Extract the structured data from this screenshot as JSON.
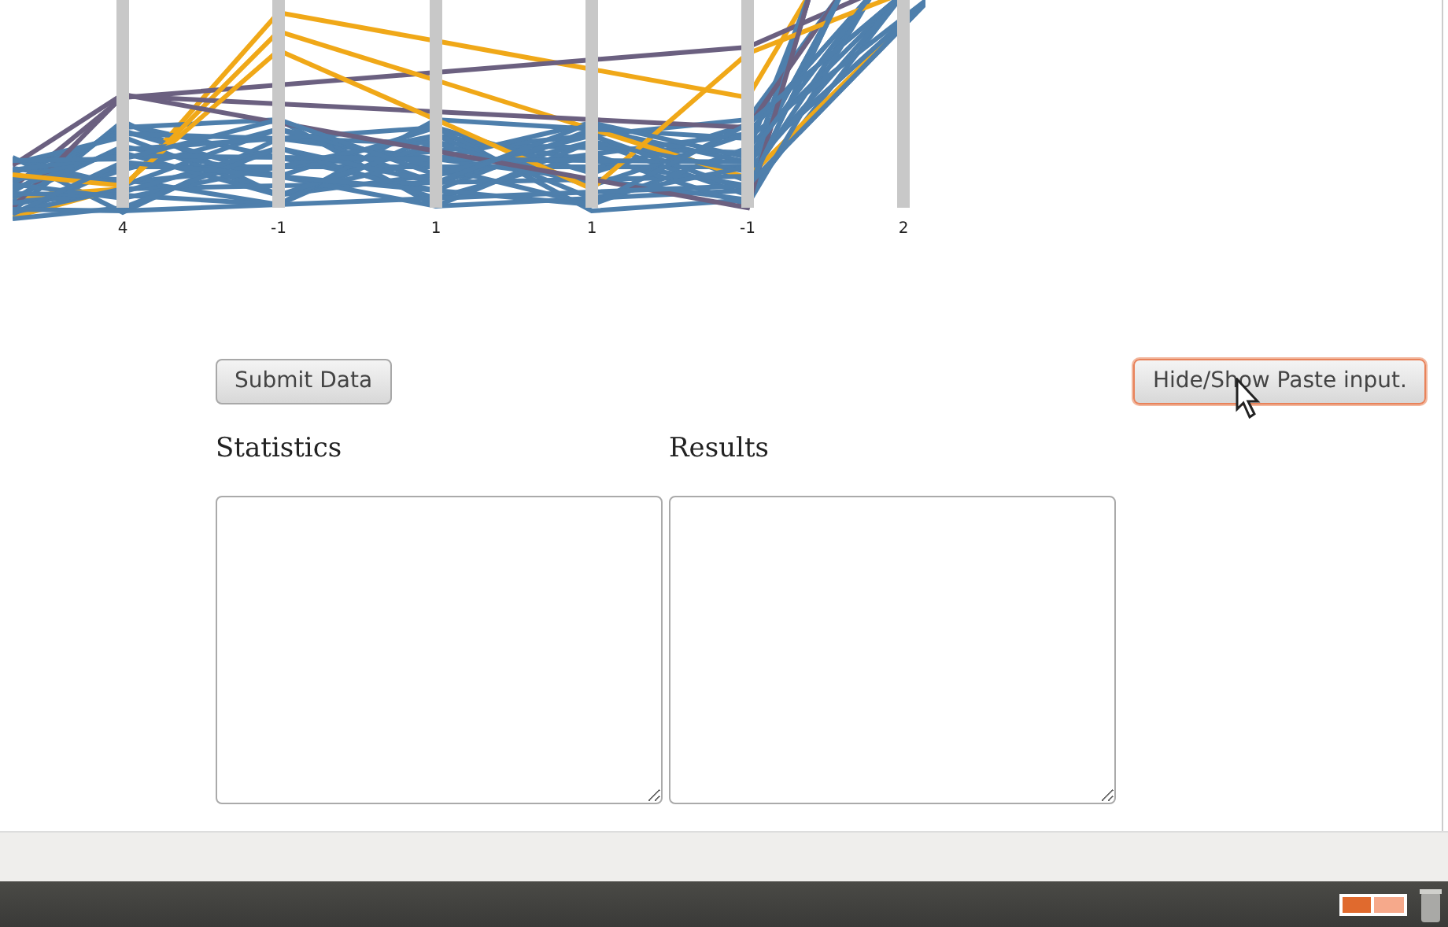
{
  "chart": {
    "axis_labels": [
      "4",
      "-1",
      "1",
      "1",
      "-1",
      "2"
    ]
  },
  "buttons": [
    {
      "label": "Submit Data",
      "focused": false
    },
    {
      "label": "Hide/Show Paste input.",
      "focused": true
    }
  ],
  "panels": [
    {
      "heading": "Statistics"
    },
    {
      "heading": "Results"
    }
  ]
}
